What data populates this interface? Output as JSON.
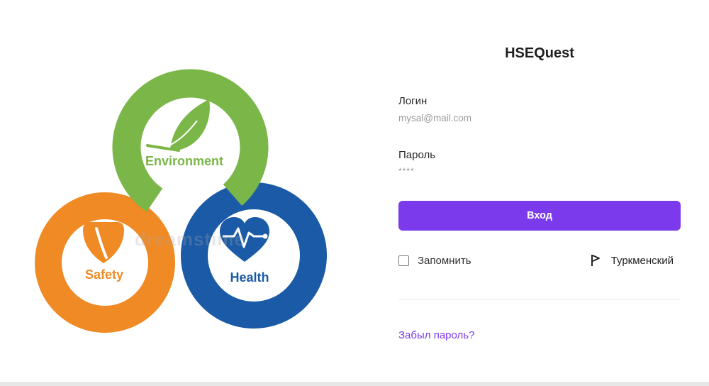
{
  "app": {
    "title": "HSEQuest"
  },
  "login": {
    "label": "Логин",
    "value": "mysal@mail.com"
  },
  "password": {
    "label": "Пароль",
    "value": "****"
  },
  "submit_label": "Вход",
  "remember": {
    "label": "Запомнить",
    "checked": false
  },
  "language": {
    "label": "Туркменский",
    "icon": "flag-icon"
  },
  "forgot_password_label": "Забыл пароль?",
  "illustration": {
    "labels": {
      "environment": "Environment",
      "safety": "Safety",
      "health": "Health"
    },
    "watermark": "dreamstime",
    "colors": {
      "environment": "#7ab648",
      "safety": "#f08a24",
      "health": "#1b5aa6"
    },
    "icons": [
      "leaf-icon",
      "shield-icon",
      "heart-pulse-icon"
    ]
  },
  "theme": {
    "accent": "#7c3aed"
  }
}
